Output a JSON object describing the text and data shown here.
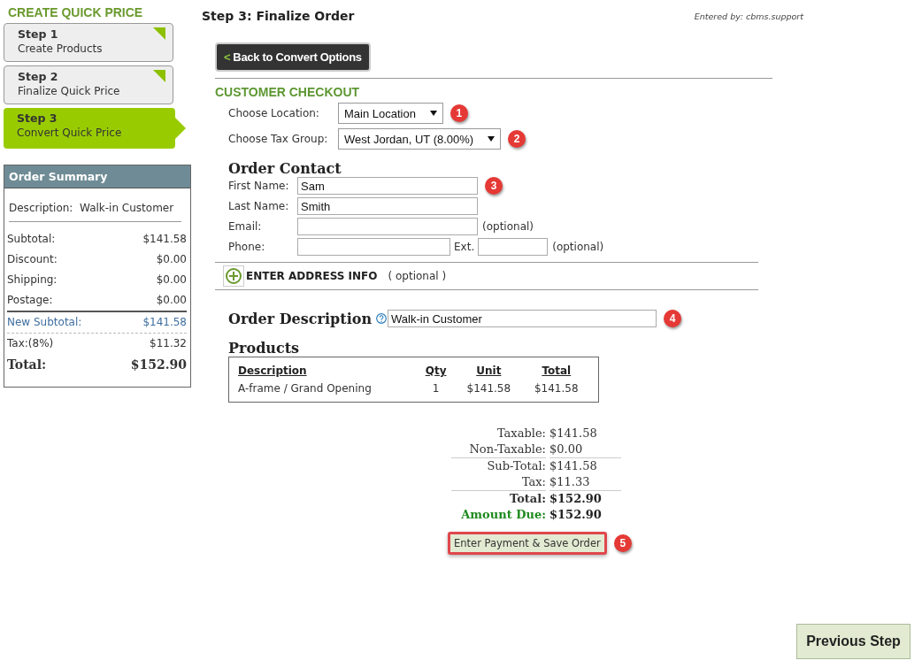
{
  "sidebar": {
    "title": "CREATE QUICK PRICE",
    "steps": [
      {
        "label": "Step 1",
        "name": "Create Products",
        "selected": false,
        "completed": true
      },
      {
        "label": "Step 2",
        "name": "Finalize Quick Price",
        "selected": false,
        "completed": true
      },
      {
        "label": "Step 3",
        "name": "Convert Quick Price",
        "selected": true,
        "completed": false
      }
    ],
    "summary": {
      "title": "Order Summary",
      "description_label": "Description:",
      "description": "Walk-in Customer",
      "rows": [
        {
          "label": "Subtotal:",
          "value": "$141.58",
          "kind": "normal"
        },
        {
          "label": "Discount:",
          "value": "$0.00",
          "kind": "normal"
        },
        {
          "label": "Shipping:",
          "value": "$0.00",
          "kind": "normal"
        },
        {
          "label": "Postage:",
          "value": "$0.00",
          "kind": "normal"
        },
        {
          "label": "New Subtotal:",
          "value": "$141.58",
          "kind": "subtotal"
        },
        {
          "label": "Tax:(8%)",
          "value": "$11.32",
          "kind": "normal"
        },
        {
          "label": "Total:",
          "value": "$152.90",
          "kind": "total"
        }
      ]
    }
  },
  "page": {
    "title": "Step 3: Finalize Order",
    "entered_by": "Entered by:  cbms.support",
    "back_arrow": "<",
    "back_button": "Back to Convert Options",
    "section_title": "CUSTOMER CHECKOUT"
  },
  "selects": [
    {
      "label": "Choose Location:",
      "value": "Main Location",
      "callout": "1"
    },
    {
      "label": "Choose Tax Group:",
      "value": "West Jordan, UT (8.00%)",
      "callout": "2"
    }
  ],
  "contact": {
    "title": "Order Contact",
    "callout": "3",
    "fields": [
      {
        "label": "First Name:",
        "value": "Sam",
        "kind": "text"
      },
      {
        "label": "Last Name:",
        "value": "Smith",
        "kind": "text"
      },
      {
        "label": "Email:",
        "note": "(optional)",
        "kind": "email"
      },
      {
        "label": "Phone:",
        "ext_label": "Ext.",
        "note": "(optional)",
        "kind": "phone"
      }
    ]
  },
  "address": {
    "label": "ENTER ADDRESS INFO",
    "note": "( optional )",
    "expanded": false
  },
  "order_description": {
    "label": "Order Description",
    "value": "Walk-in Customer",
    "callout": "4"
  },
  "products": {
    "title": "Products",
    "columns": [
      "Description",
      "Qty",
      "Unit",
      "Total"
    ],
    "rows": [
      [
        "A-frame / Grand Opening",
        "1",
        "$141.58",
        "$141.58"
      ]
    ]
  },
  "totals": [
    {
      "label": "Taxable:",
      "value": "$141.58",
      "kind": "normal"
    },
    {
      "label": "Non-Taxable:",
      "value": "$0.00",
      "kind": "normal"
    },
    {
      "label": "Sub-Total:",
      "value": "$141.58",
      "kind": "ruled"
    },
    {
      "label": "Tax:",
      "value": "$11.33",
      "kind": "normal"
    },
    {
      "label": "Total:",
      "value": "$152.90",
      "kind": "total"
    },
    {
      "label": "Amount Due:",
      "value": "$152.90",
      "kind": "due"
    }
  ],
  "save_button": {
    "label": "Enter Payment & Save Order",
    "callout": "5"
  },
  "previous_button": "Previous Step"
}
